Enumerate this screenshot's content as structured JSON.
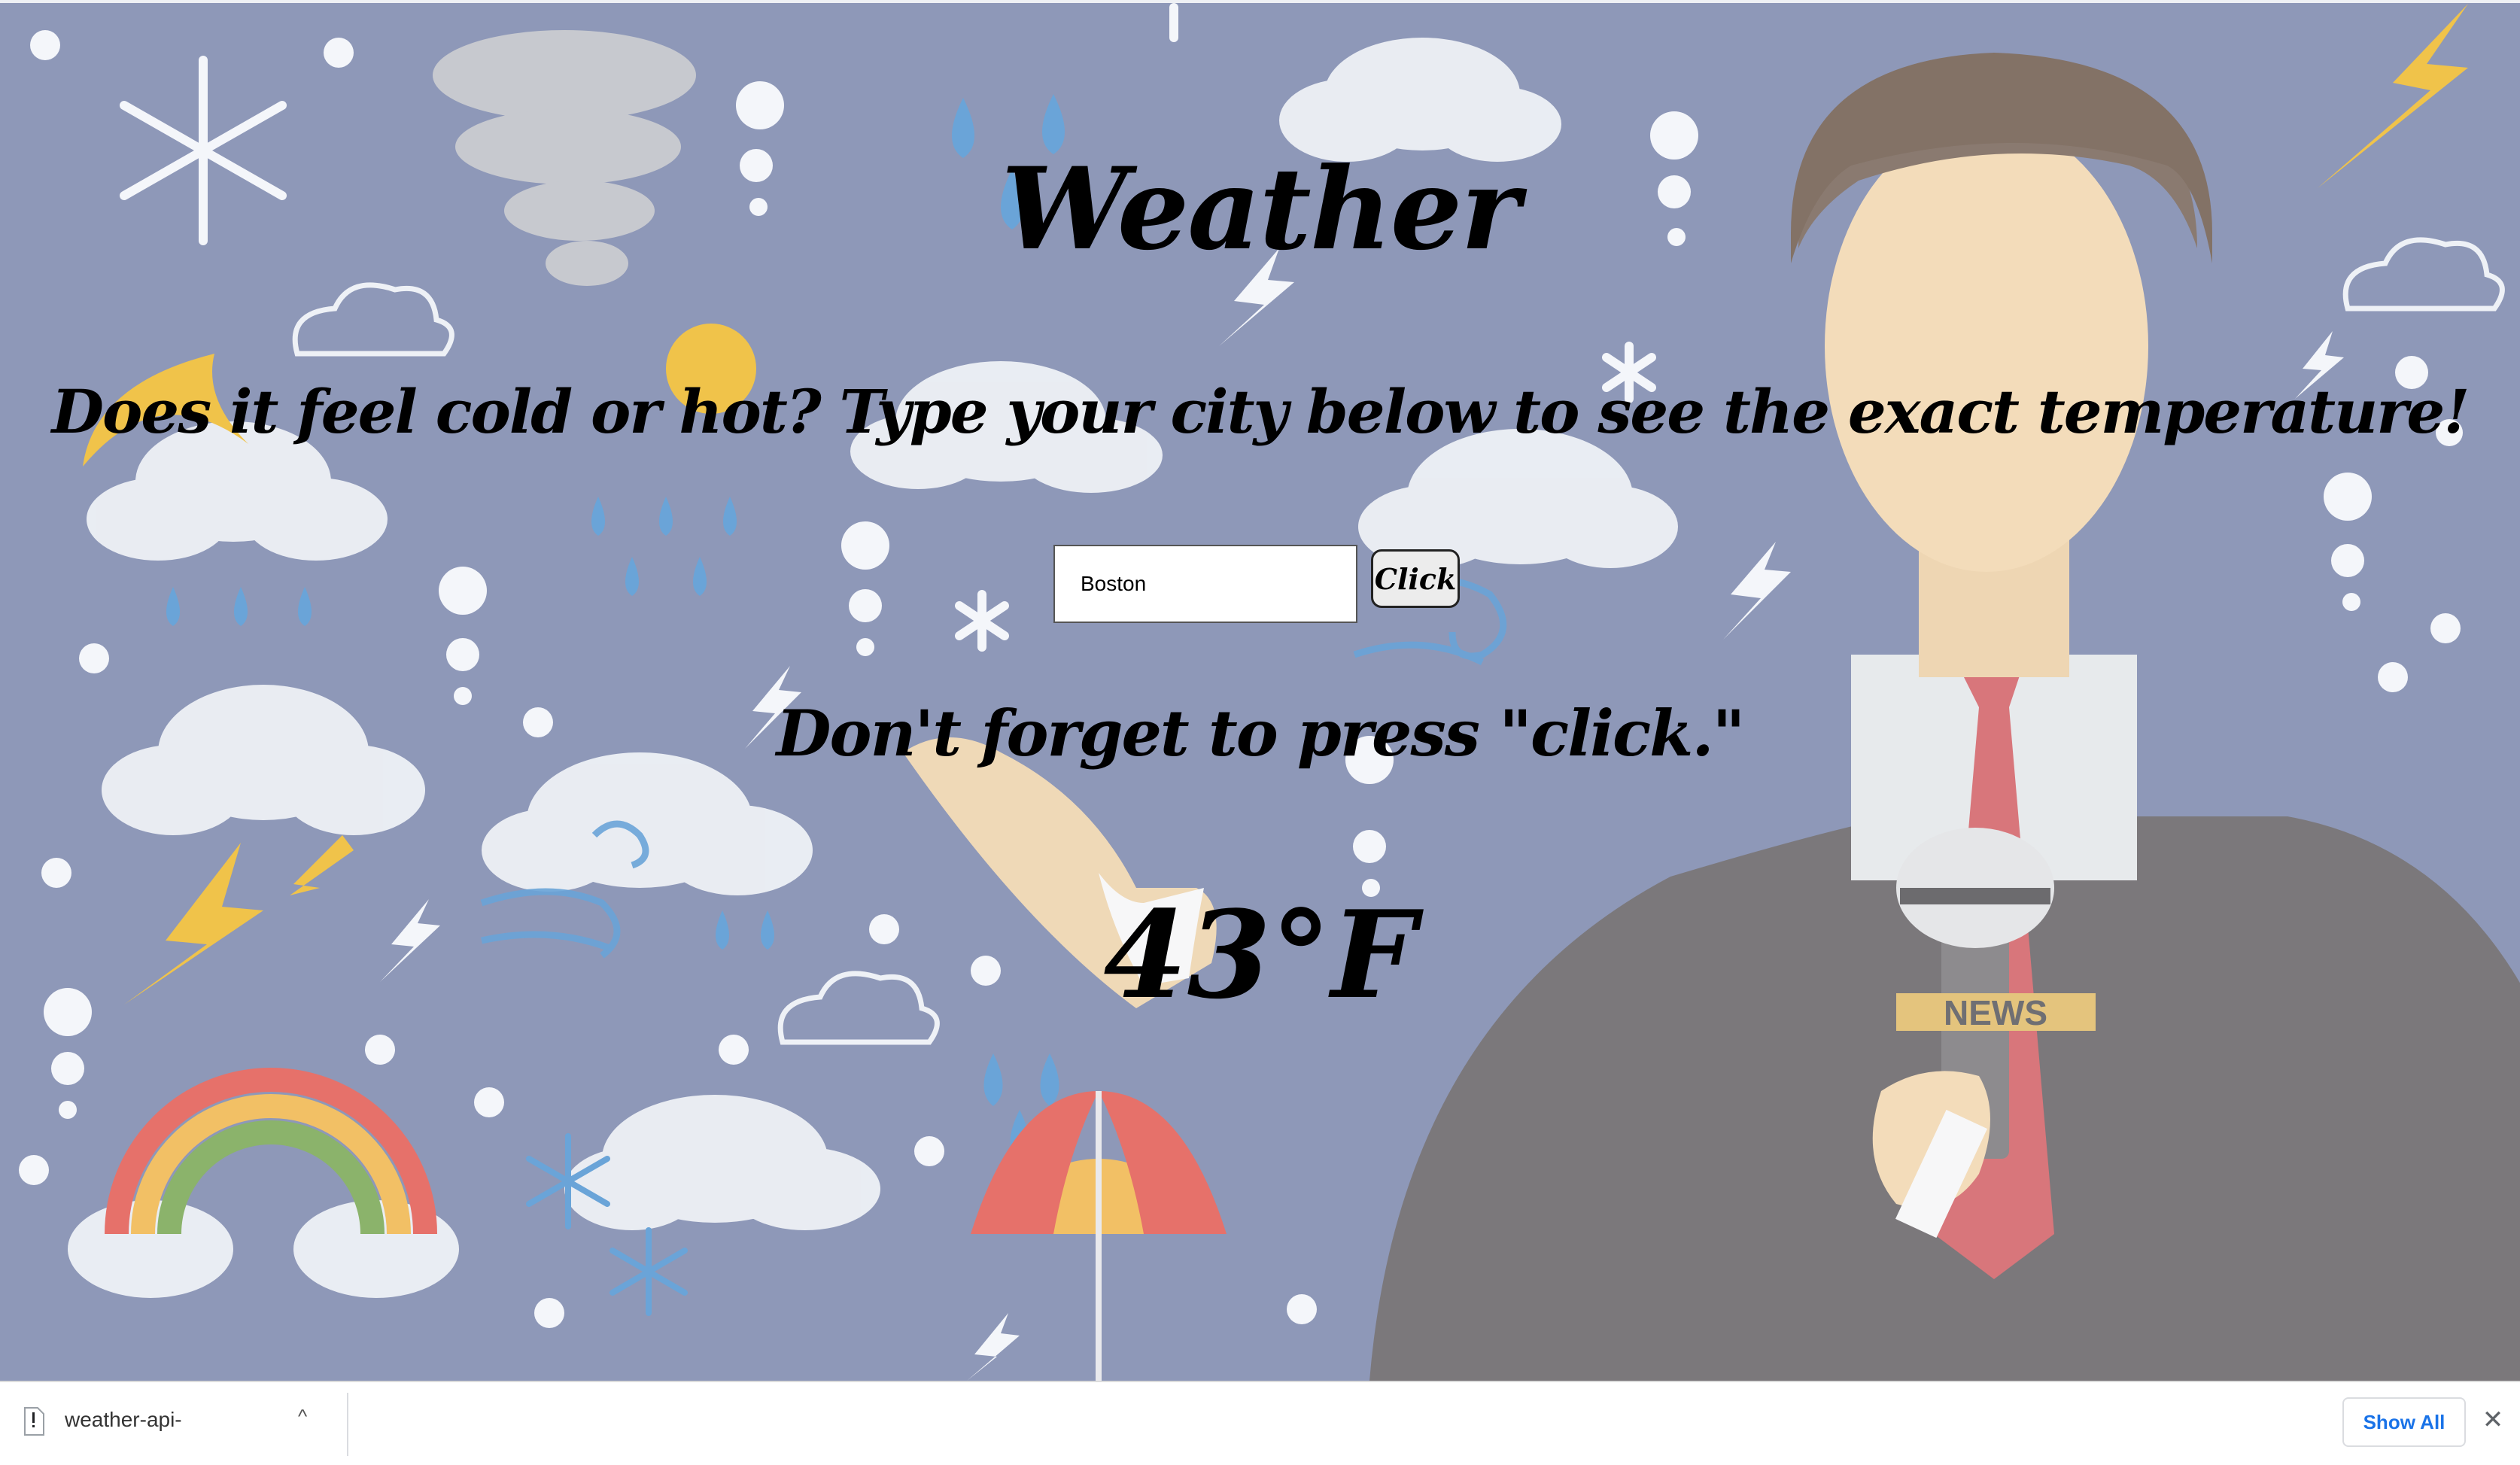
{
  "heading": {
    "title": "Weather",
    "subtitle": "Does it feel cold or hot? Type your city below to see the exact temperature!"
  },
  "search": {
    "city_value": "Boston",
    "button_label": "Click"
  },
  "reminder": "Don't forget to press \"click.\"",
  "result": {
    "temperature": "43°F"
  },
  "background": {
    "badge_text": "NEWS"
  },
  "download_bar": {
    "file_name": "weather-api-",
    "show_all_label": "Show All",
    "close_glyph": "✕",
    "chevron_glyph": "^"
  },
  "colors": {
    "page_background": "#8e98b8",
    "text": "#000000",
    "show_all_text": "#1a73e8"
  }
}
